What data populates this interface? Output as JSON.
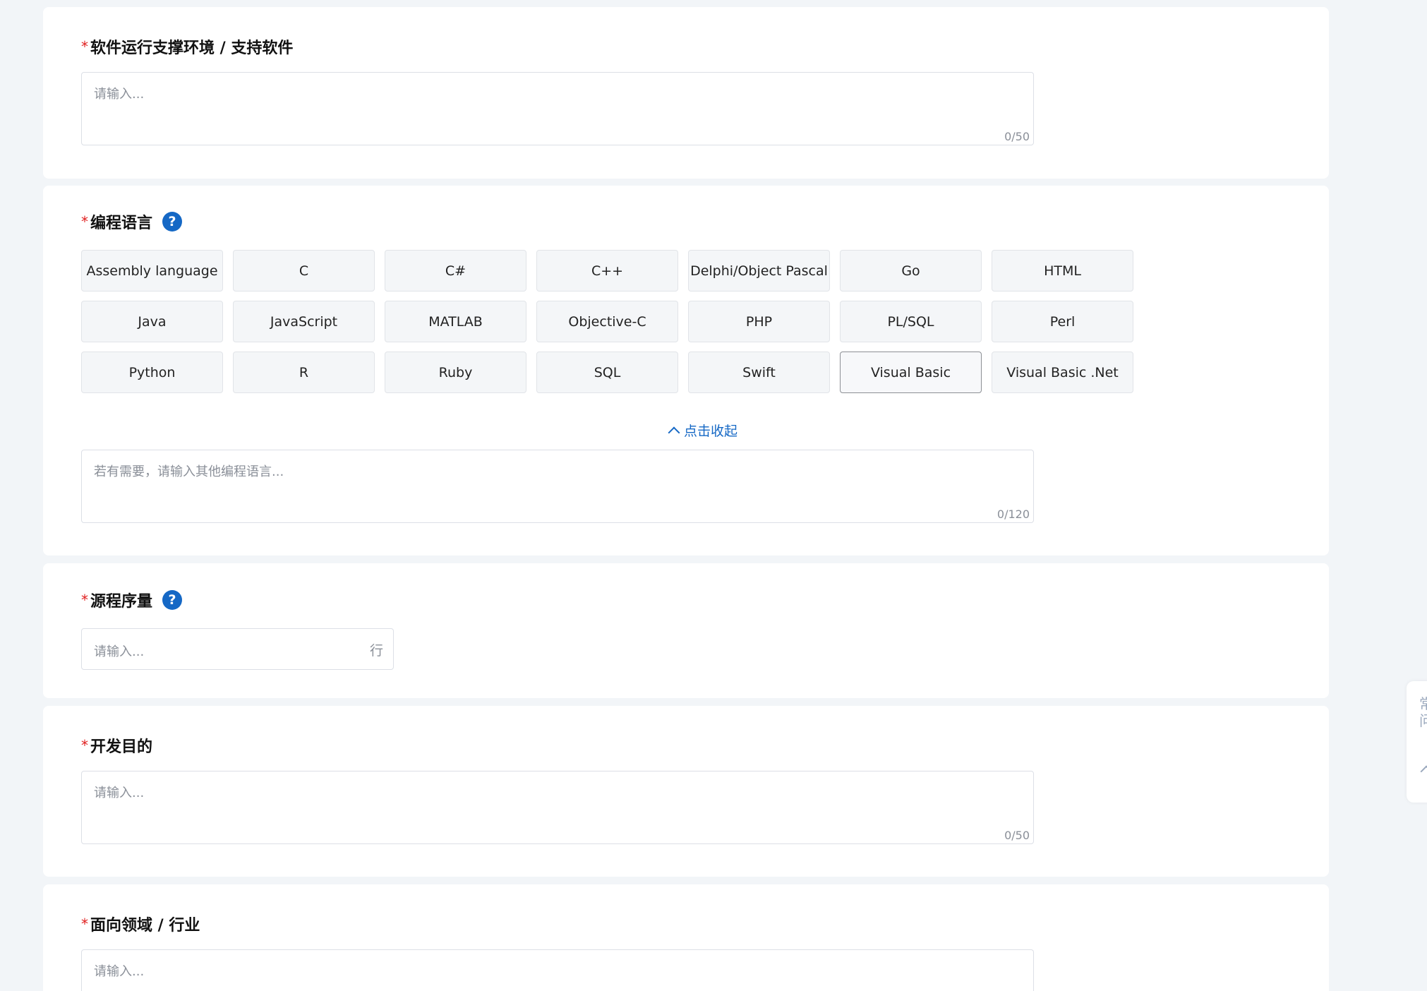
{
  "sections": {
    "support_env": {
      "label": "软件运行支撑环境 / 支持软件",
      "required": "*",
      "placeholder": "请输入...",
      "counter": "0/50"
    },
    "programming_language": {
      "label": "编程语言",
      "required": "*",
      "help": "?",
      "languages": [
        "Assembly language",
        "C",
        "C#",
        "C++",
        "Delphi/Object Pascal",
        "Go",
        "HTML",
        "Java",
        "JavaScript",
        "MATLAB",
        "Objective-C",
        "PHP",
        "PL/SQL",
        "Perl",
        "Python",
        "R",
        "Ruby",
        "SQL",
        "Swift",
        "Visual Basic",
        "Visual Basic .Net"
      ],
      "selected": "Visual Basic",
      "collapse_label": "点击收起",
      "other_placeholder": "若有需要，请输入其他编程语言...",
      "counter": "0/120"
    },
    "source_lines": {
      "label": "源程序量",
      "required": "*",
      "help": "?",
      "placeholder": "请输入...",
      "unit": "行"
    },
    "dev_purpose": {
      "label": "开发目的",
      "required": "*",
      "placeholder": "请输入...",
      "counter": "0/50"
    },
    "industry": {
      "label": "面向领域 / 行业",
      "required": "*",
      "placeholder": "请输入..."
    }
  },
  "side_tab": {
    "text": "常问"
  },
  "colors": {
    "accent": "#1568c5",
    "required": "#e02020",
    "background": "#f2f5f8"
  }
}
